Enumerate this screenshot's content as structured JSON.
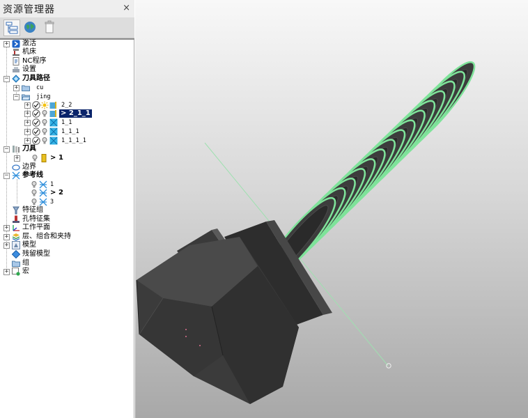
{
  "panel": {
    "title": "资源管理器",
    "close_glyph": "×"
  },
  "toolbar": {
    "buttons": [
      {
        "icon": "tree-view-icon",
        "active": true
      },
      {
        "icon": "globe-icon",
        "active": false
      },
      {
        "icon": "trash-icon",
        "active": false
      }
    ]
  },
  "tree": {
    "activate": "激活",
    "machine": "机床",
    "nc_program": "NC程序",
    "settings": "设置",
    "toolpaths": "刀具路径",
    "folder_cu": "cu",
    "folder_jing": "jing",
    "tp_2_2": "2_2",
    "tp_2_1_1_marker": ">",
    "tp_2_1_1": "2_1_1",
    "tp_1_1": "1_1",
    "tp_1_1_1": "1_1_1",
    "tp_1_1_1_1": "1_1_1_1",
    "tools": "刀具",
    "tool_1_marker": ">",
    "tool_1": "1",
    "boundary": "边界",
    "reference_lines": "参考线",
    "ref_1": "1",
    "ref_2_marker": ">",
    "ref_2": "2",
    "ref_3": "3",
    "feature_group": "特征组",
    "hole_feature_set": "孔特征集",
    "workplane": "工作平面",
    "layers": "层、组合和夹持",
    "model": "模型",
    "stock_model": "残留模型",
    "group": "组",
    "macro": "宏"
  },
  "viewport": {
    "model": "hex-bolt-3d-model",
    "colors": {
      "background_top": "#f8f8f8",
      "background_bottom": "#a8a8a8",
      "model_body": "#3c3c3c",
      "toolpath": "#7fe39a",
      "axis_line": "#9fe0b0"
    }
  }
}
